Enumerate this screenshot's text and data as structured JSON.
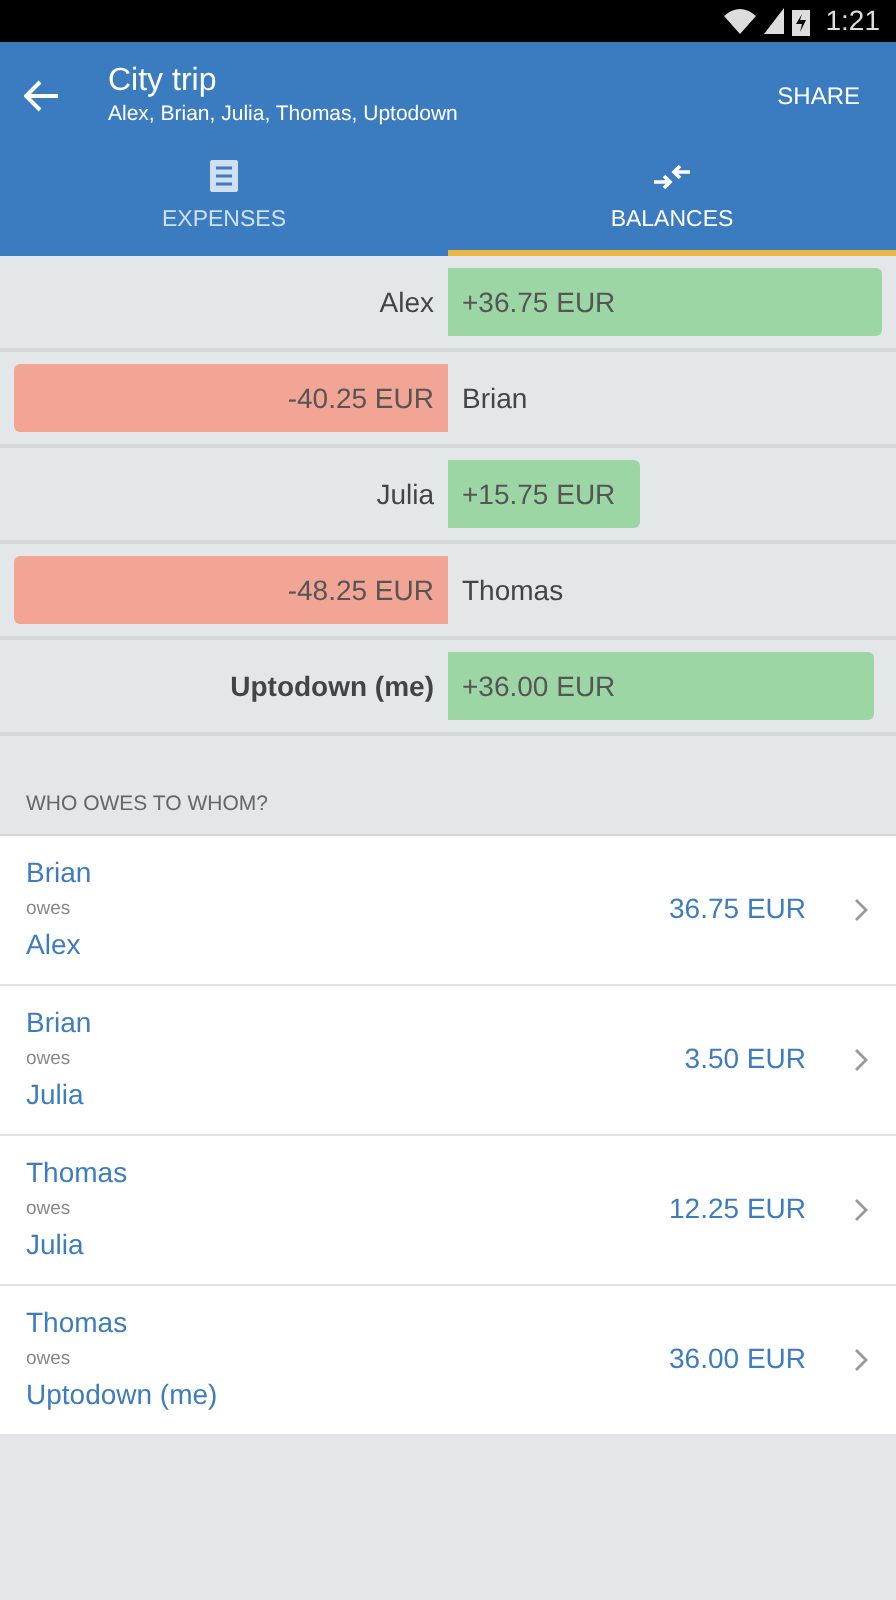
{
  "status_bar": {
    "time": "1:21"
  },
  "toolbar": {
    "title": "City trip",
    "subtitle": "Alex, Brian, Julia, Thomas, Uptodown",
    "action": "SHARE"
  },
  "tabs": [
    {
      "label": "EXPENSES",
      "selected": false
    },
    {
      "label": "BALANCES",
      "selected": true
    }
  ],
  "balances": [
    {
      "name": "Alex",
      "amount": "+36.75 EUR",
      "kind": "positive",
      "is_me": false
    },
    {
      "name": "Brian",
      "amount": "-40.25 EUR",
      "kind": "negative",
      "is_me": false
    },
    {
      "name": "Julia",
      "amount": "+15.75 EUR",
      "kind": "positive",
      "is_me": false
    },
    {
      "name": "Thomas",
      "amount": "-48.25 EUR",
      "kind": "negative",
      "is_me": false
    },
    {
      "name": "Uptodown (me)",
      "amount": "+36.00 EUR",
      "kind": "positive",
      "is_me": true
    }
  ],
  "debts_heading": "WHO OWES TO WHOM?",
  "debts": [
    {
      "from": "Brian",
      "verb": "owes",
      "to": "Alex",
      "amount": "36.75 EUR"
    },
    {
      "from": "Brian",
      "verb": "owes",
      "to": "Julia",
      "amount": "3.50 EUR"
    },
    {
      "from": "Thomas",
      "verb": "owes",
      "to": "Julia",
      "amount": "12.25 EUR"
    },
    {
      "from": "Thomas",
      "verb": "owes",
      "to": "Uptodown (me)",
      "amount": "36.00 EUR"
    }
  ]
}
